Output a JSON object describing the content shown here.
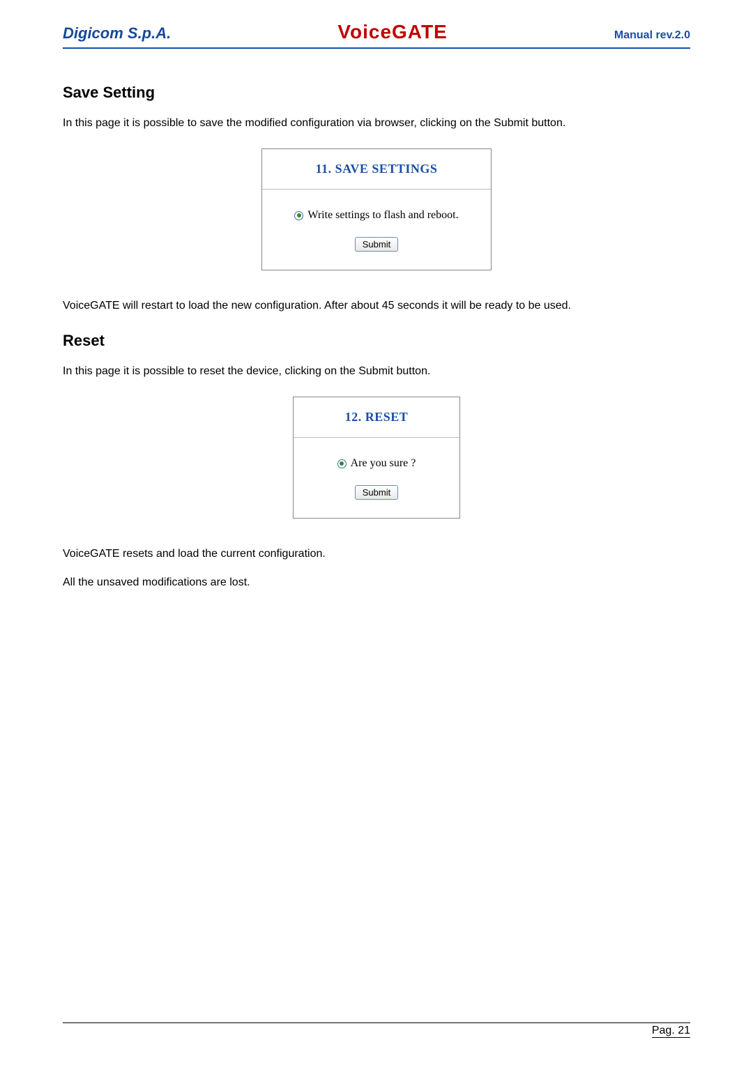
{
  "header": {
    "brand": "Digicom S.p.A.",
    "product": "VoiceGATE",
    "manual": "Manual rev.2.0"
  },
  "section1": {
    "title": "Save Setting",
    "intro": "In this page it is possible to save the modified configuration via browser, clicking on the Submit button.",
    "panel_title": "11. SAVE SETTINGS",
    "radio_label": "Write settings to flash and reboot.",
    "submit": "Submit",
    "after": "VoiceGATE will restart to load the new configuration. After about 45 seconds it will be ready to be used."
  },
  "section2": {
    "title": "Reset",
    "intro": "In this page it is possible to reset the device, clicking on the Submit button.",
    "panel_title": "12. RESET",
    "radio_label": "Are you sure ?",
    "submit": "Submit",
    "after1": "VoiceGATE resets and load the current configuration.",
    "after2": "All the unsaved modifications are lost."
  },
  "footer": {
    "page": "Pag. 21"
  }
}
